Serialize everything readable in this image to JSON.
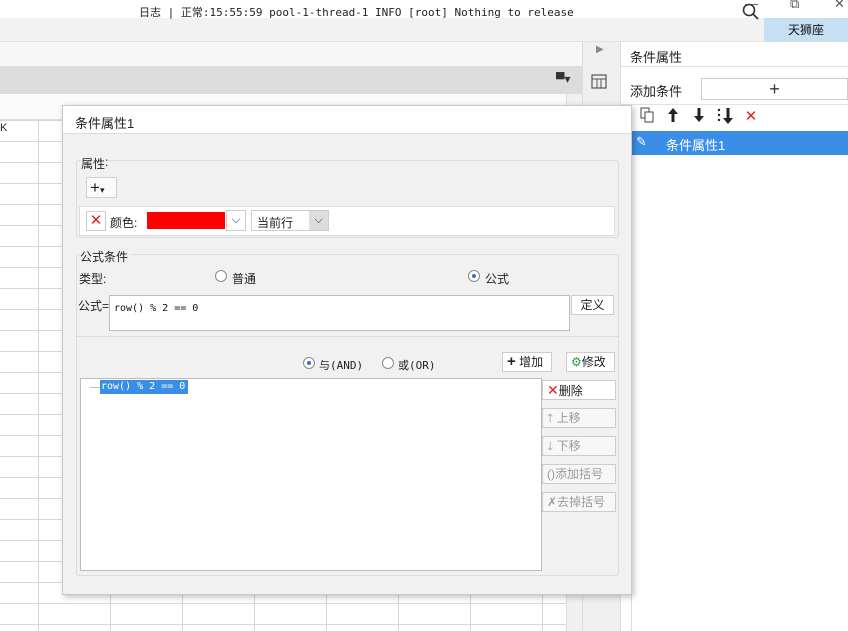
{
  "window": {
    "controls": [
      "—",
      "⧉",
      "✕"
    ]
  },
  "logbar": {
    "text": "日志 | 正常:15:55:59 pool-1-thread-1 INFO [root] Nothing to release",
    "user": "天狮座"
  },
  "sheet": {
    "column_label": "K"
  },
  "right_panel": {
    "title": "条件属性",
    "add_label": "添加条件",
    "add_button": "+",
    "toolbar_icons": [
      "copy-icon",
      "arrow-up-icon",
      "arrow-down-icon",
      "move-bottom-icon",
      "delete-icon"
    ],
    "selected_item": "条件属性1"
  },
  "dialog": {
    "title": "条件属性1",
    "property_section": "属性",
    "add_property_button": "+",
    "color_label": "颜色:",
    "color_value": "#ff0000",
    "scope_value": "当前行",
    "formula_section": "公式条件",
    "type_label": "类型:",
    "type_options": [
      "普通",
      "公式"
    ],
    "selected_type": "公式",
    "formula_label": "公式=",
    "formula_value": "row() % 2 == 0",
    "define_button": "定义",
    "and_label": "与(AND)",
    "or_label": "或(OR)",
    "add_button": "增加",
    "modify_button": "修改",
    "delete_button": "删除",
    "move_up_button": "上移",
    "move_down_button": "下移",
    "add_bracket_button": "添加括号",
    "remove_bracket_button": "去掉括号",
    "condition_items": [
      "row() % 2 == 0"
    ]
  }
}
